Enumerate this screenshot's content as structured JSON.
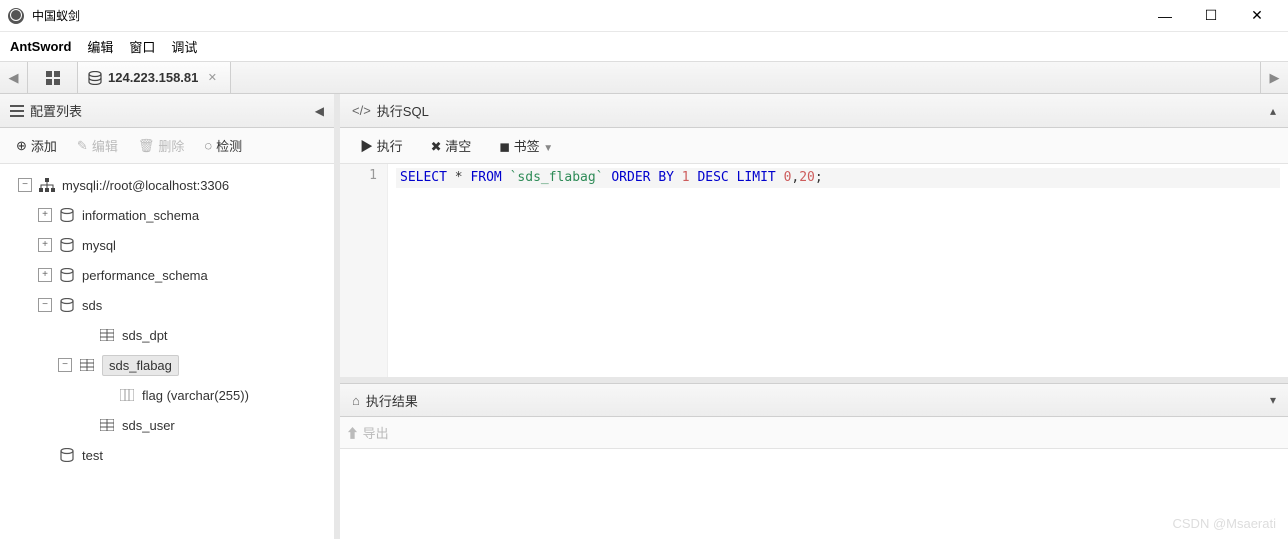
{
  "window": {
    "title": "中国蚁剑"
  },
  "menubar": {
    "brand": "AntSword",
    "items": [
      "编辑",
      "窗口",
      "调试"
    ]
  },
  "tabbar": {
    "tab_label": "124.223.158.81"
  },
  "sidebar": {
    "panel_title": "配置列表",
    "toolbar": {
      "add": "添加",
      "edit": "编辑",
      "delete": "删除",
      "detect": "检测"
    },
    "tree": {
      "root": "mysqli://root@localhost:3306",
      "dbs": [
        {
          "name": "information_schema"
        },
        {
          "name": "mysql"
        },
        {
          "name": "performance_schema"
        },
        {
          "name": "sds",
          "expanded": true,
          "tables": [
            {
              "name": "sds_dpt"
            },
            {
              "name": "sds_flabag",
              "selected": true,
              "expanded": true,
              "columns": [
                {
                  "name": "flag (varchar(255))"
                }
              ]
            },
            {
              "name": "sds_user"
            }
          ]
        },
        {
          "name": "test"
        }
      ]
    }
  },
  "sql": {
    "panel_title": "执行SQL",
    "toolbar": {
      "execute": "执行",
      "clear": "清空",
      "bookmark": "书签"
    },
    "editor": {
      "line_num": "1",
      "tokens": [
        {
          "t": "SELECT",
          "c": "kw"
        },
        {
          "t": " ",
          "c": ""
        },
        {
          "t": "*",
          "c": "punct"
        },
        {
          "t": " ",
          "c": ""
        },
        {
          "t": "FROM",
          "c": "kw"
        },
        {
          "t": " ",
          "c": ""
        },
        {
          "t": "`sds_flabag`",
          "c": "str"
        },
        {
          "t": " ",
          "c": ""
        },
        {
          "t": "ORDER",
          "c": "kw"
        },
        {
          "t": " ",
          "c": ""
        },
        {
          "t": "BY",
          "c": "kw"
        },
        {
          "t": " ",
          "c": ""
        },
        {
          "t": "1",
          "c": "num"
        },
        {
          "t": " ",
          "c": ""
        },
        {
          "t": "DESC",
          "c": "kw"
        },
        {
          "t": " ",
          "c": ""
        },
        {
          "t": "LIMIT",
          "c": "kw"
        },
        {
          "t": " ",
          "c": ""
        },
        {
          "t": "0",
          "c": "num"
        },
        {
          "t": ",",
          "c": "punct"
        },
        {
          "t": "20",
          "c": "num"
        },
        {
          "t": ";",
          "c": "punct"
        }
      ]
    }
  },
  "result": {
    "panel_title": "执行结果",
    "export": "导出"
  },
  "watermark": "CSDN @Msaerati"
}
